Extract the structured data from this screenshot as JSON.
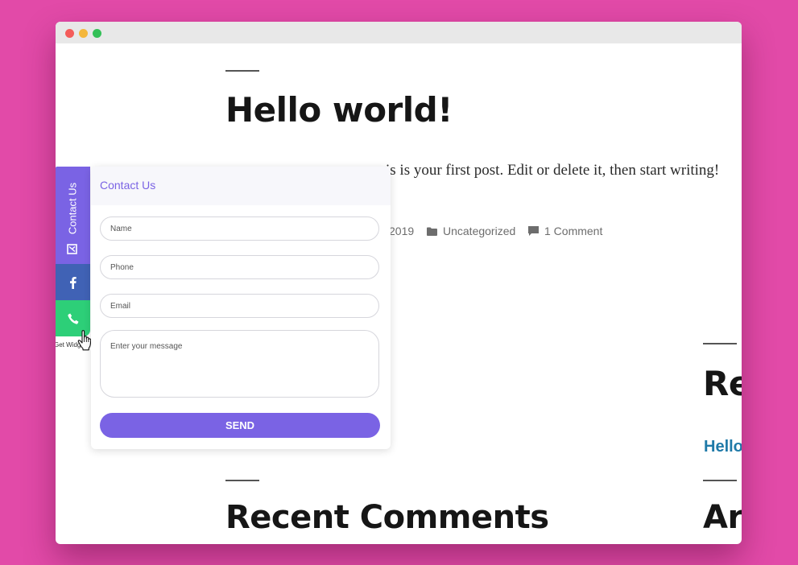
{
  "colors": {
    "background": "#e24aa8",
    "accent": "#7a63e4",
    "facebook": "#4062b5",
    "phone": "#2dcf78",
    "link": "#1f7aa8"
  },
  "post": {
    "title": "Hello world!",
    "text_visible": "is is your first post. Edit or delete it, then start writing!",
    "date_fragment": "2019",
    "category": "Uncategorized",
    "comments": "1 Comment"
  },
  "sidebar_right": {
    "heading_fragment": "Re",
    "link_fragment": "Hello",
    "heading2_fragment": "Ar"
  },
  "footer_widgets": {
    "recent_comments_title": "Recent Comments"
  },
  "widget": {
    "tab_contact_label": "Contact Us",
    "tab_mail_icon": "mail-icon",
    "tab_facebook_icon": "facebook-icon",
    "tab_phone_icon": "phone-icon",
    "credit": "Get Widget",
    "panel_title": "Contact Us",
    "name_placeholder": "Name",
    "phone_placeholder": "Phone",
    "email_placeholder": "Email",
    "message_placeholder": "Enter your message",
    "send_label": "SEND"
  }
}
